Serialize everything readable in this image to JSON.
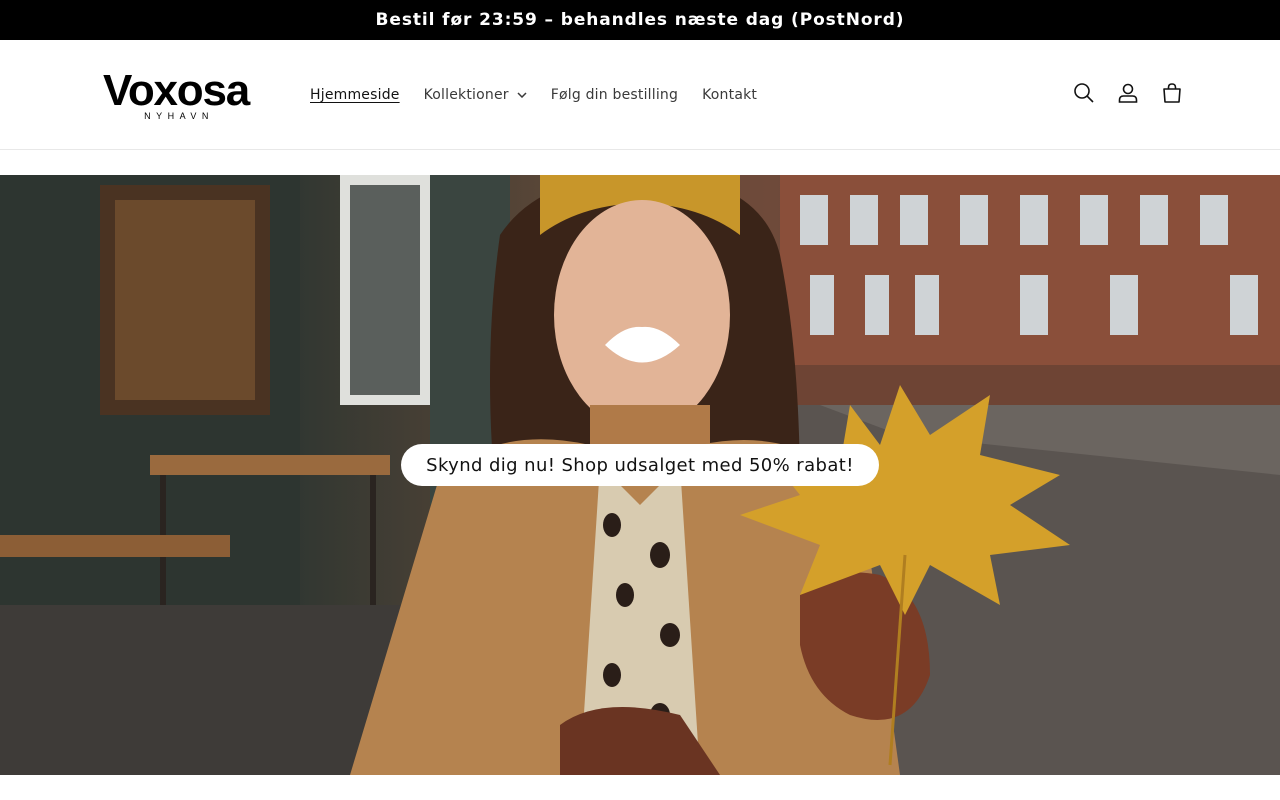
{
  "announcement": {
    "text": "Bestil før 23:59 – behandles næste dag (PostNord)"
  },
  "logo": {
    "name": "Voxosa",
    "tagline": "NYHAVN"
  },
  "nav": {
    "items": [
      {
        "label": "Hjemmeside"
      },
      {
        "label": "Kollektioner"
      },
      {
        "label": "Følg din bestilling"
      },
      {
        "label": "Kontakt"
      }
    ]
  },
  "header_icons": [
    "search-icon",
    "account-icon",
    "cart-icon"
  ],
  "hero": {
    "cta_label": "Skynd dig nu! Shop udsalget med 50% rabat!"
  },
  "colors": {
    "announcement_bg": "#000000",
    "page_bg": "#ffffff",
    "text": "#121212"
  }
}
